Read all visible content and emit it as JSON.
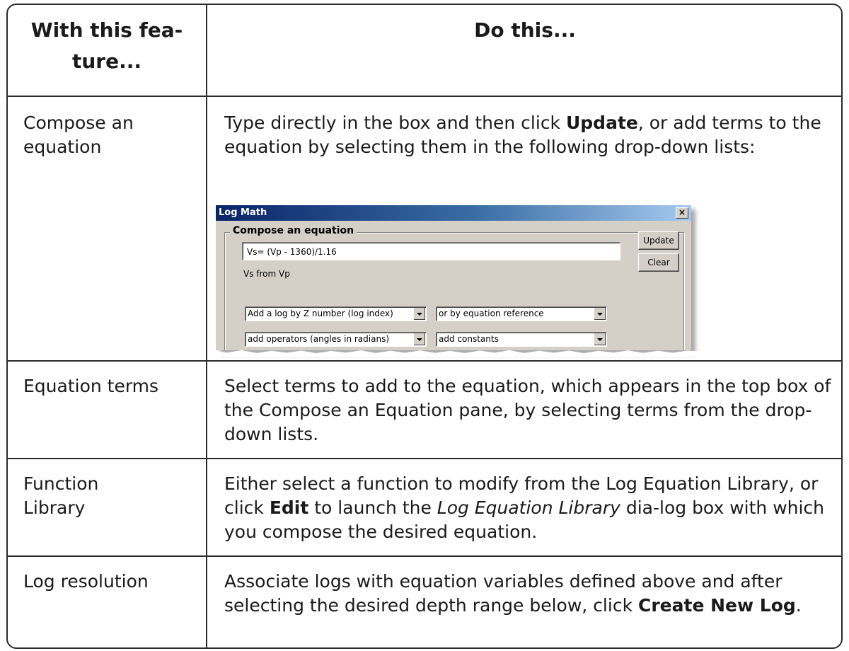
{
  "header": {
    "col1": "With this fea-\nture...",
    "col1_line1": "With this fea-",
    "col1_line2": "ture...",
    "col2": "Do this..."
  },
  "rows": [
    {
      "feature_line1": "Compose an",
      "feature_line2": "equation",
      "desc_before": "Type directly in the box and then click ",
      "desc_bold": "Update",
      "desc_after": ", or add terms to the equation by selecting them in the following drop-down lists:"
    },
    {
      "feature": "Equation terms",
      "desc": "Select terms to add to the equation, which appears in the top box of the Compose an Equation pane, by selecting terms from the drop-down lists."
    },
    {
      "feature_line1": "Function",
      "feature_line2": "Library",
      "desc_before": "Either select a function to modify from the Log Equation Library, or click ",
      "desc_bold": "Edit",
      "desc_mid": " to launch the ",
      "desc_italic": "Log Equation Library",
      "desc_after": " dia-log box with which you compose the desired equation."
    },
    {
      "feature": "Log resolution",
      "desc_before": "Associate logs with equation variables defined above and after selecting the desired depth range below, click ",
      "desc_bold": "Create New Log",
      "desc_after": "."
    }
  ],
  "dialog": {
    "title": "Log Math",
    "close": "×",
    "group_label": "Compose an equation",
    "equation_value": "Vs= (Vp - 1360)/1.16",
    "equation_desc": "Vs from Vp",
    "update_label": "Update",
    "clear_label": "Clear",
    "select_log_index": "Add a log by Z number (log index)",
    "select_eq_ref": "or by equation reference",
    "select_operators": "add operators (angles in radians)",
    "select_constants": "add constants",
    "icons": [
      "close-icon",
      "dropdown-arrow-icon"
    ]
  }
}
